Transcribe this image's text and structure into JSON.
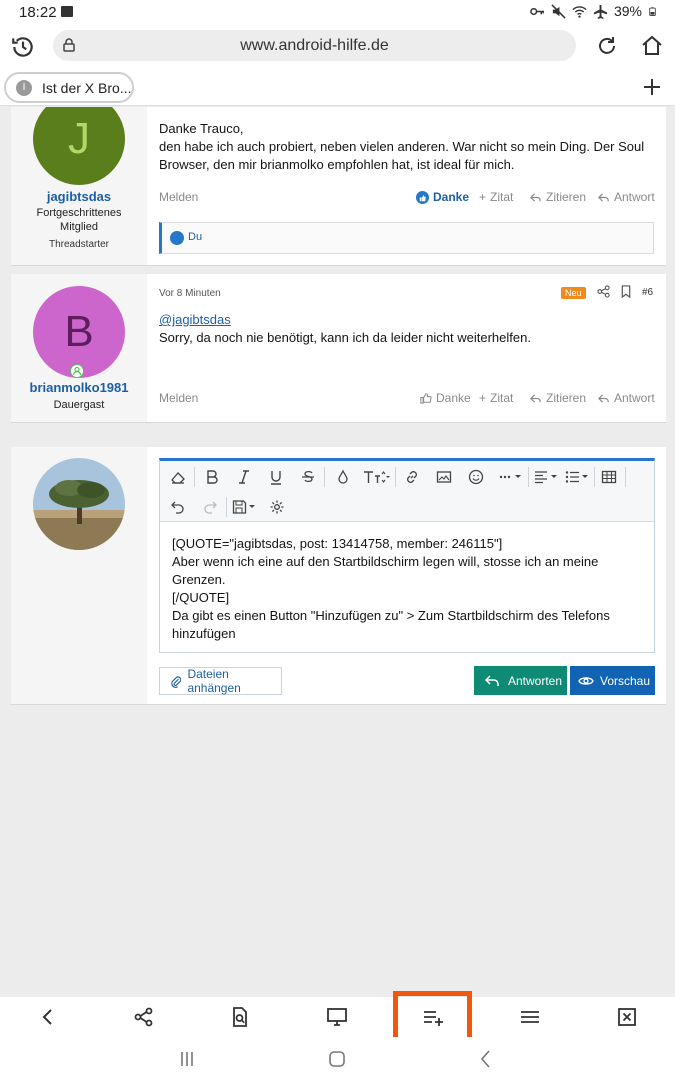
{
  "status_bar": {
    "time": "18:22",
    "battery": "39%"
  },
  "browser": {
    "url": "www.android-hilfe.de",
    "tab_title": "Ist der X Bro...",
    "tab_favicon_letter": "I"
  },
  "posts": [
    {
      "username": "jagibtsdas",
      "user_title": "Fortgeschrittenes Mitglied",
      "user_badge": "Threadstarter",
      "avatar_letter": "J",
      "avatar_color": "#5b7e1c",
      "avatar_letter_color": "#b3d66a",
      "message_lines": [
        "Danke Trauco,",
        "den habe ich auch probiert, neben vielen anderen. War nicht so mein Ding. Der Soul Browser, den mir brianmolko empfohlen hat, ist ideal für mich."
      ],
      "actions": {
        "report": "Melden",
        "thanks": "Danke",
        "quote_plus": "Zitat",
        "quote": "Zitieren",
        "reply": "Antwort"
      },
      "likes_text": "Du"
    },
    {
      "username": "brianmolko1981",
      "user_title": "Dauergast",
      "avatar_letter": "B",
      "avatar_color": "#cc66cc",
      "avatar_letter_color": "#5e1e5e",
      "date": "Vor 8 Minuten",
      "badge": "Neu",
      "post_number": "#6",
      "mention": "@jagibtsdas",
      "message": "Sorry, da noch nie benötigt, kann ich da leider nicht weiterhelfen.",
      "actions": {
        "report": "Melden",
        "thanks": "Danke",
        "quote_plus": "Zitat",
        "quote": "Zitieren",
        "reply": "Antwort"
      }
    }
  ],
  "editor": {
    "lines": [
      "[QUOTE=\"jagibtsdas, post: 13414758, member: 246115\"]",
      "Aber wenn ich eine auf den Startbildschirm legen will, stosse ich an meine Grenzen.",
      "[/QUOTE]",
      "Da gibt es einen Button \"Hinzufügen zu\" > Zum Startbildschirm des Telefons hinzufügen"
    ],
    "attach_label": "Dateien anhängen",
    "reply_label": "Antworten",
    "preview_label": "Vorschau"
  },
  "colors": {
    "link": "#1d5fa6",
    "reply_button": "#0e8a75",
    "preview_button": "#1164b4",
    "highlight": "#f2580c",
    "badge_new": "#f08a1c"
  }
}
